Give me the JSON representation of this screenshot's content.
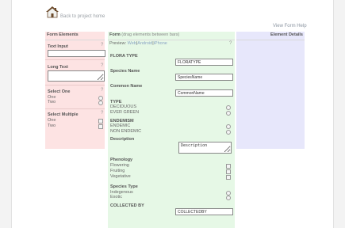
{
  "nav": {
    "back_label": "Back to project home",
    "help_label": "View Form Help"
  },
  "left": {
    "header": "Form Elements",
    "text_input_label": "Text Input",
    "long_text_label": "Long Text",
    "select_one_label": "Select One",
    "select_one_options": [
      "One",
      "Two"
    ],
    "select_multiple_label": "Select Multiple",
    "select_multiple_options": [
      "One",
      "Two"
    ],
    "help_mark": "?"
  },
  "middle": {
    "header": "Form",
    "header_sub": "(drag elements between bars)",
    "help_mark": "?",
    "preview_label": "Preview:",
    "preview_web": "Web",
    "preview_android": "Android",
    "preview_iphone": "iPhone",
    "sep": "|",
    "fields": {
      "flora_type": {
        "label": "FLORA TYPE",
        "value": "FLORATYPE"
      },
      "species_name": {
        "label": "Species Name",
        "value": "SpeciesName"
      },
      "common_name": {
        "label": "Common Name",
        "value": "CommonName"
      },
      "type": {
        "label": "TYPE",
        "options": [
          "DECIDUOUS",
          "EVER GREEN"
        ]
      },
      "endemism": {
        "label": "ENDEMISM",
        "options": [
          "ENDEMIC",
          "NON ENDEMIC"
        ]
      },
      "description": {
        "label": "Description",
        "value": "Description"
      },
      "phenology": {
        "label": "Phenology",
        "options": [
          "Flowering",
          "Fruiting",
          "Vegetative"
        ]
      },
      "species_type": {
        "label": "Species Type",
        "options": [
          "Indegenous",
          "Exotic"
        ]
      },
      "collected_by": {
        "label": "COLLECTED BY",
        "value": "COLLECTEDBY"
      }
    }
  },
  "right": {
    "header": "Element Details"
  }
}
